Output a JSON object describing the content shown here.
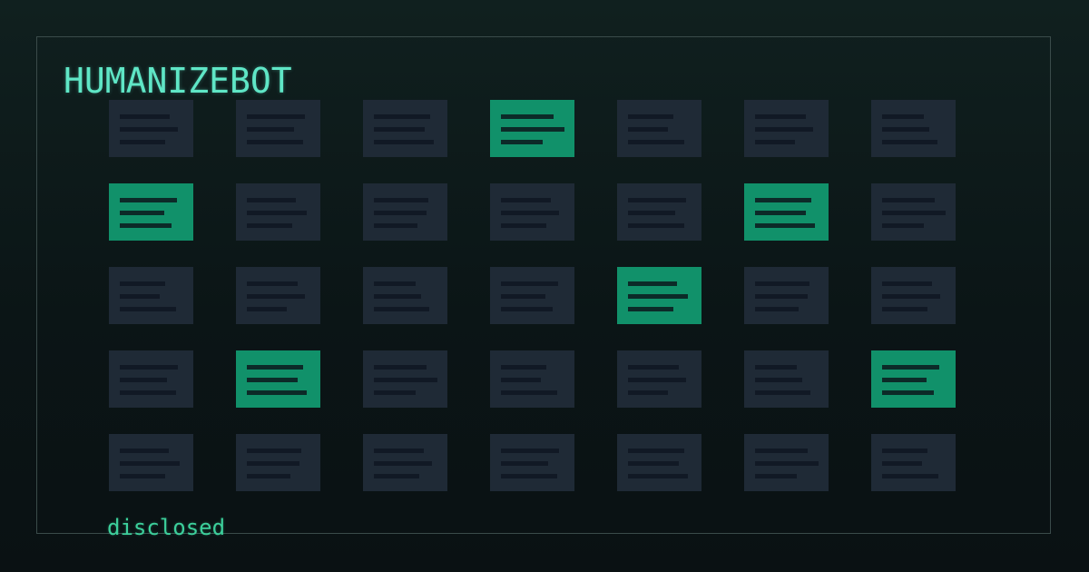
{
  "brand": {
    "title": "HUMANIZEBOT"
  },
  "footer": {
    "label": "disclosed"
  },
  "colors": {
    "background": "#0d1a1a",
    "tile": "#1f2a36",
    "tile_highlight": "#11916a",
    "text_accent": "#5fe6c6",
    "footer_text": "#3ccf9b"
  },
  "grid": {
    "rows": 5,
    "columns": 7,
    "highlighted": [
      [
        0,
        3
      ],
      [
        1,
        0
      ],
      [
        1,
        5
      ],
      [
        2,
        4
      ],
      [
        3,
        1
      ],
      [
        3,
        6
      ]
    ]
  }
}
